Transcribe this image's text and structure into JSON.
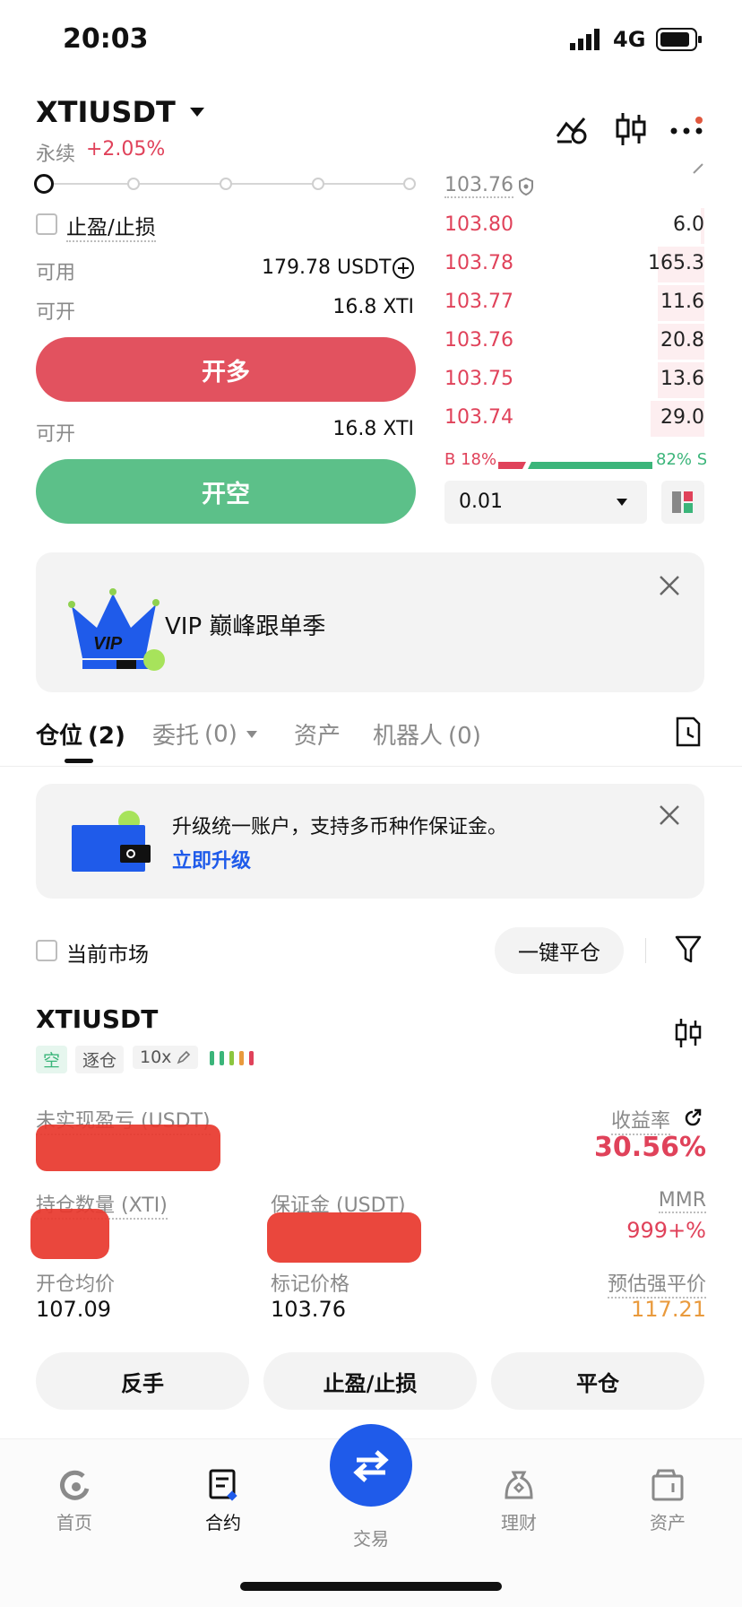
{
  "status_bar": {
    "time": "20:03",
    "network": "4G"
  },
  "header": {
    "symbol": "XTIUSDT",
    "type": "永续",
    "change": "+2.05%"
  },
  "order_form": {
    "tp_sl_label": "止盈/止损",
    "available_label": "可用",
    "available_value": "179.78 USDT",
    "open_label": "可开",
    "open_long_value": "16.8 XTI",
    "open_long_button": "开多",
    "open_short_value": "16.8 XTI",
    "open_short_button": "开空"
  },
  "orderbook": {
    "mark_price": "103.76",
    "asks": [
      {
        "price": "103.80",
        "qty": "6.0"
      },
      {
        "price": "103.78",
        "qty": "165.3"
      },
      {
        "price": "103.77",
        "qty": "11.6"
      },
      {
        "price": "103.76",
        "qty": "20.8"
      },
      {
        "price": "103.75",
        "qty": "13.6"
      },
      {
        "price": "103.74",
        "qty": "29.0"
      }
    ],
    "buy_ratio_label": "B 18%",
    "sell_ratio_label": "82% S",
    "buy_ratio": 0.18,
    "precision": "0.01"
  },
  "promo": {
    "text": "VIP 巅峰跟单季",
    "badge": "VIP"
  },
  "tabs": [
    {
      "label": "仓位",
      "count": "(2)"
    },
    {
      "label": "委托",
      "count": "(0)"
    },
    {
      "label": "资产",
      "count": ""
    },
    {
      "label": "机器人",
      "count": "(0)"
    }
  ],
  "upgrade_banner": {
    "text": "升级统一账户，支持多币种作保证金。",
    "link": "立即升级"
  },
  "filter": {
    "current_market": "当前市场",
    "close_all": "一键平仓"
  },
  "position": {
    "symbol": "XTIUSDT",
    "side": "空",
    "margin_mode": "逐仓",
    "leverage": "10x",
    "unrealized_pnl_label": "未实现盈亏 (USDT)",
    "roe_label": "收益率",
    "roe_value": "30.56%",
    "size_label": "持仓数量 (XTI)",
    "margin_label": "保证金 (USDT)",
    "mmr_label": "MMR",
    "mmr_value": "999+%",
    "entry_label": "开仓均价",
    "entry_value": "107.09",
    "mark_label": "标记价格",
    "mark_value": "103.76",
    "liq_label": "预估强平价",
    "liq_value": "117.21",
    "btn_reverse": "反手",
    "btn_tpsl": "止盈/止损",
    "btn_close": "平仓"
  },
  "bottom_nav": [
    {
      "label": "首页"
    },
    {
      "label": "合约"
    },
    {
      "label": "交易"
    },
    {
      "label": "理财"
    },
    {
      "label": "资产"
    }
  ]
}
